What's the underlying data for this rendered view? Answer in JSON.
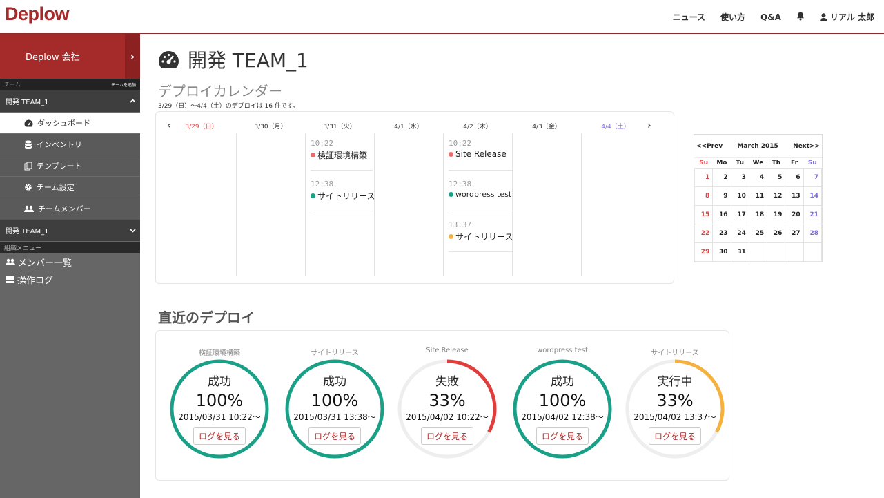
{
  "brand": {
    "logo": "Deplow",
    "accent": "#a52a2a"
  },
  "topnav": {
    "news": "ニュース",
    "howto": "使い方",
    "qa": "Q&A",
    "bell_icon": "bell-icon",
    "user": "リアル 太郎"
  },
  "sidebar": {
    "company": "Deplow 会社",
    "team_label": "チーム",
    "team_add": "チームを追加",
    "team1": "開発 TEAM_1",
    "items": [
      {
        "label": "ダッシュボード",
        "icon": "dashboard-icon"
      },
      {
        "label": "インベントリ",
        "icon": "database-icon"
      },
      {
        "label": "テンプレート",
        "icon": "copy-icon"
      },
      {
        "label": "チーム設定",
        "icon": "gear-icon"
      },
      {
        "label": "チームメンバー",
        "icon": "users-icon"
      }
    ],
    "team2": "開発 TEAM_1",
    "org_label": "組織メニュー",
    "org_items": [
      {
        "label": "メンバー一覧",
        "icon": "users-icon"
      },
      {
        "label": "操作ログ",
        "icon": "list-icon"
      }
    ]
  },
  "main": {
    "title": "開発 TEAM_1",
    "calendar_title": "デプロイカレンダー",
    "range_note": "3/29（日）～4/4（土）のデプロイは 16 件です。",
    "days": [
      "3/29（日）",
      "3/30（月）",
      "3/31（火）",
      "4/1（水）",
      "4/2（木）",
      "4/3（金）",
      "4/4（土）"
    ],
    "events": {
      "d2": [
        {
          "time": "10:22",
          "name": "検証環境構築",
          "color": "#ef6b6b"
        },
        {
          "time": "12:38",
          "name": "サイトリリース",
          "color": "#1aa086"
        }
      ],
      "d4": [
        {
          "time": "10:22",
          "name": "Site Release",
          "color": "#ef6b6b"
        },
        {
          "time": "12:38",
          "name": "wordpress test",
          "color": "#1aa086"
        },
        {
          "time": "13:37",
          "name": "サイトリリース",
          "color": "#f5b13d"
        }
      ]
    },
    "recent_title": "直近のデプロイ"
  },
  "mini_calendar": {
    "prev": "<<Prev",
    "next": "Next>>",
    "month": "March 2015",
    "weekdays": [
      "Su",
      "Mo",
      "Tu",
      "We",
      "Th",
      "Fr",
      "Su"
    ],
    "weeks": [
      [
        "1",
        "2",
        "3",
        "4",
        "5",
        "6",
        "7"
      ],
      [
        "8",
        "9",
        "10",
        "11",
        "12",
        "13",
        "14"
      ],
      [
        "15",
        "16",
        "17",
        "18",
        "19",
        "20",
        "21"
      ],
      [
        "22",
        "23",
        "24",
        "25",
        "26",
        "27",
        "28"
      ],
      [
        "29",
        "30",
        "31",
        "",
        "",
        "",
        ""
      ]
    ]
  },
  "recent": [
    {
      "name": "検証環境構築",
      "status": "成功",
      "pct": "100%",
      "percent": 100,
      "time": "2015/03/31 10:22～",
      "button": "ログを見る",
      "color": "#1aa086"
    },
    {
      "name": "サイトリリース",
      "status": "成功",
      "pct": "100%",
      "percent": 100,
      "time": "2015/03/31 13:38～",
      "button": "ログを見る",
      "color": "#1aa086"
    },
    {
      "name": "Site Release",
      "status": "失敗",
      "pct": "33%",
      "percent": 33,
      "time": "2015/04/02 10:22～",
      "button": "ログを見る",
      "color": "#e03d3d"
    },
    {
      "name": "wordpress test",
      "status": "成功",
      "pct": "100%",
      "percent": 100,
      "time": "2015/04/02 12:38～",
      "button": "ログを見る",
      "color": "#1aa086"
    },
    {
      "name": "サイトリリース",
      "status": "実行中",
      "pct": "33%",
      "percent": 33,
      "time": "2015/04/02 13:37～",
      "button": "ログを見る",
      "color": "#f5b13d"
    }
  ]
}
